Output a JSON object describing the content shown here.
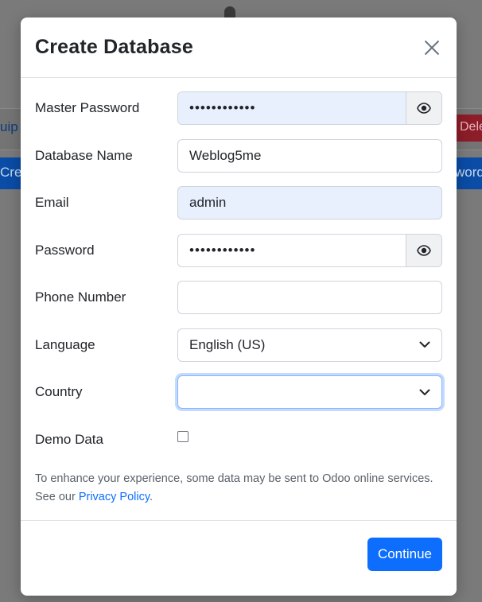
{
  "background": {
    "left_partial_text": "uip",
    "right_button_partial": "Dele",
    "left_blue_partial": "Crea",
    "right_blue_partial": "word"
  },
  "modal": {
    "title": "Create Database",
    "fields": {
      "master_password": {
        "label": "Master Password",
        "value": "••••••••••••"
      },
      "database_name": {
        "label": "Database Name",
        "value": "Weblog5me"
      },
      "email": {
        "label": "Email",
        "value": "admin"
      },
      "password": {
        "label": "Password",
        "value": "••••••••••••"
      },
      "phone_number": {
        "label": "Phone Number",
        "value": ""
      },
      "language": {
        "label": "Language",
        "value": "English (US)"
      },
      "country": {
        "label": "Country",
        "value": ""
      },
      "demo_data": {
        "label": "Demo Data",
        "checked": false
      }
    },
    "notice": {
      "text_before": "To enhance your experience, some data may be sent to Odoo online services. See our ",
      "link": "Privacy Policy",
      "text_after": "."
    },
    "continue_label": "Continue"
  },
  "colors": {
    "primary": "#0d6efd",
    "autofill_bg": "#e8f0fe",
    "overlay": "#7a7a7a"
  },
  "icons": [
    "eye-icon",
    "close-icon",
    "chevron-down-icon"
  ]
}
